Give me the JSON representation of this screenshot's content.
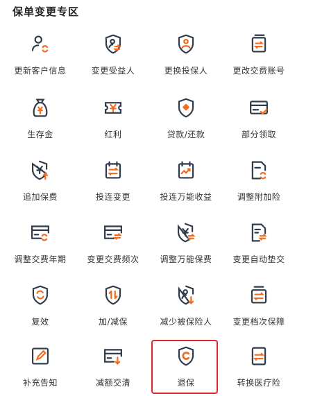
{
  "section": {
    "title": "保单变更专区"
  },
  "colors": {
    "icon_dark": "#2f3a4a",
    "accent": "#f26b21",
    "selected": "#e0262c"
  },
  "items": [
    {
      "label": "更新客户信息",
      "icon": "user-refresh-icon"
    },
    {
      "label": "变更受益人",
      "icon": "user-shield-swap-icon"
    },
    {
      "label": "更换投保人",
      "icon": "shield-person-icon"
    },
    {
      "label": "更改交费账号",
      "icon": "card-swap-icon"
    },
    {
      "label": "生存金",
      "icon": "money-bag-icon"
    },
    {
      "label": "红利",
      "icon": "ticket-yen-icon"
    },
    {
      "label": "贷款/还款",
      "icon": "shield-dot-icon"
    },
    {
      "label": "部分领取",
      "icon": "card-check-icon"
    },
    {
      "label": "追加保费",
      "icon": "shield-yen-up-icon"
    },
    {
      "label": "投连变更",
      "icon": "calendar-swap-icon"
    },
    {
      "label": "投连万能收益",
      "icon": "calendar-trend-icon"
    },
    {
      "label": "调整附加险",
      "icon": "doc-refresh-icon"
    },
    {
      "label": "调整交费年期",
      "icon": "card-refresh-icon"
    },
    {
      "label": "变更交费频次",
      "icon": "card-swap-icon"
    },
    {
      "label": "调整万能保费",
      "icon": "shield-yen-swap-icon"
    },
    {
      "label": "变更自动垫交",
      "icon": "doc-swap-icon"
    },
    {
      "label": "复效",
      "icon": "shield-refresh-icon"
    },
    {
      "label": "加/减保",
      "icon": "shield-updown-icon"
    },
    {
      "label": "减少被保险人",
      "icon": "shield-person-down-icon"
    },
    {
      "label": "变更档次保障",
      "icon": "box-swap-icon"
    },
    {
      "label": "补充告知",
      "icon": "edit-square-icon"
    },
    {
      "label": "减额交清",
      "icon": "card-down-icon"
    },
    {
      "label": "退保",
      "icon": "shield-return-icon"
    },
    {
      "label": "转换医疗险",
      "icon": "doc-swap-icon"
    }
  ]
}
